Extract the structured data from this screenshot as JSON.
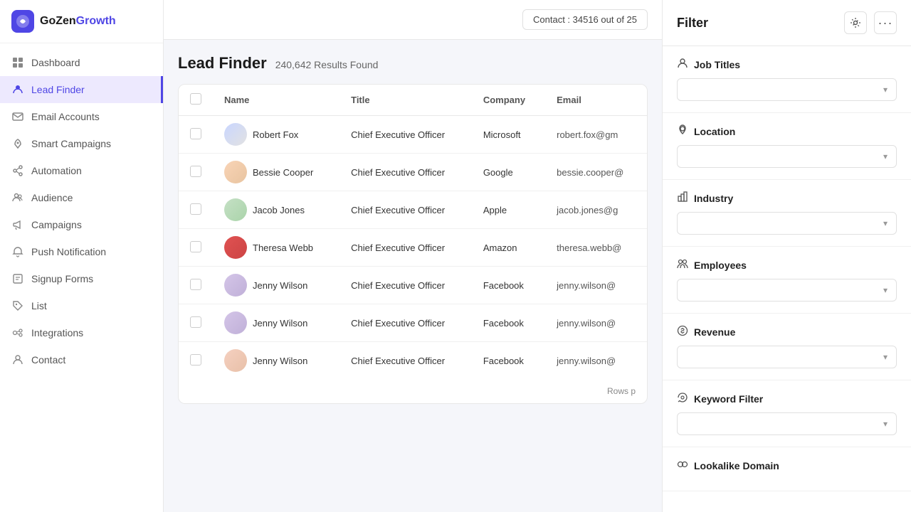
{
  "app": {
    "logo_gozen": "GoZen",
    "logo_growth": "Growth",
    "contact_badge": "Contact : 34516 out of 25"
  },
  "sidebar": {
    "items": [
      {
        "id": "dashboard",
        "label": "Dashboard",
        "icon": "grid"
      },
      {
        "id": "lead-finder",
        "label": "Lead Finder",
        "icon": "users",
        "active": true
      },
      {
        "id": "email-accounts",
        "label": "Email Accounts",
        "icon": "email"
      },
      {
        "id": "smart-campaigns",
        "label": "Smart Campaigns",
        "icon": "rocket"
      },
      {
        "id": "automation",
        "label": "Automation",
        "icon": "share"
      },
      {
        "id": "audience",
        "label": "Audience",
        "icon": "audience"
      },
      {
        "id": "campaigns",
        "label": "Campaigns",
        "icon": "megaphone"
      },
      {
        "id": "push-notification",
        "label": "Push Notification",
        "icon": "bell"
      },
      {
        "id": "signup-forms",
        "label": "Signup Forms",
        "icon": "form"
      },
      {
        "id": "list",
        "label": "List",
        "icon": "tag"
      },
      {
        "id": "integrations",
        "label": "Integrations",
        "icon": "integrations"
      },
      {
        "id": "contact",
        "label": "Contact",
        "icon": "contact"
      }
    ]
  },
  "lead_finder": {
    "title": "Lead Finder",
    "results": "240,642 Results Found",
    "columns": [
      "Name",
      "Title",
      "Company",
      "Email"
    ],
    "rows": [
      {
        "name": "Robert Fox",
        "title": "Chief Executive Officer",
        "company": "Microsoft",
        "email": "robert.fox@gm",
        "avatar_class": "av1"
      },
      {
        "name": "Bessie Cooper",
        "title": "Chief Executive Officer",
        "company": "Google",
        "email": "bessie.cooper@",
        "avatar_class": "av2"
      },
      {
        "name": "Jacob Jones",
        "title": "Chief Executive Officer",
        "company": "Apple",
        "email": "jacob.jones@g",
        "avatar_class": "av3"
      },
      {
        "name": "Theresa Webb",
        "title": "Chief Executive Officer",
        "company": "Amazon",
        "email": "theresa.webb@",
        "avatar_class": "av4"
      },
      {
        "name": "Jenny Wilson",
        "title": "Chief Executive Officer",
        "company": "Facebook",
        "email": "jenny.wilson@",
        "avatar_class": "av5"
      },
      {
        "name": "Jenny Wilson",
        "title": "Chief Executive Officer",
        "company": "Facebook",
        "email": "jenny.wilson@",
        "avatar_class": "av6"
      },
      {
        "name": "Jenny Wilson",
        "title": "Chief Executive Officer",
        "company": "Facebook",
        "email": "jenny.wilson@",
        "avatar_class": "av7"
      }
    ],
    "rows_per_page_label": "Rows p"
  },
  "filter": {
    "title": "Filter",
    "sections": [
      {
        "id": "job-titles",
        "label": "Job Titles",
        "icon": "👤"
      },
      {
        "id": "location",
        "label": "Location",
        "icon": "📍"
      },
      {
        "id": "industry",
        "label": "Industry",
        "icon": "🏭"
      },
      {
        "id": "employees",
        "label": "Employees",
        "icon": "👥"
      },
      {
        "id": "revenue",
        "label": "Revenue",
        "icon": "💰"
      },
      {
        "id": "keyword-filter",
        "label": "Keyword Filter",
        "icon": "🔗"
      },
      {
        "id": "lookalike-domain",
        "label": "Lookalike Domain",
        "icon": "🔗"
      }
    ],
    "dropdown_placeholder": "",
    "gear_label": "⚙",
    "more_label": "···"
  }
}
